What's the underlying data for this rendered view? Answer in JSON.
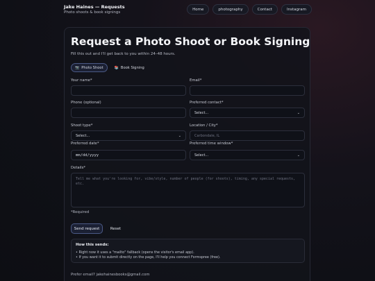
{
  "header": {
    "title": "Jake Haines — Requests",
    "subtitle": "Photo shoots & book signings",
    "nav": [
      "Home",
      "photography",
      "Contact",
      "Instagram"
    ]
  },
  "form": {
    "title": "Request a Photo Shoot or Book Signing",
    "intro": "Fill this out and I'll get back to you within 24–48 hours.",
    "tabs": [
      {
        "icon": "camera-icon",
        "label": "Photo Shoot",
        "active": true
      },
      {
        "icon": "books-icon",
        "label": "Book Signing",
        "active": false
      }
    ],
    "name_label": "Your name*",
    "email_label": "Email*",
    "phone_label": "Phone (optional)",
    "contact_label": "Preferred contact*",
    "contact_value": "Select...",
    "shoot_type_label": "Shoot type*",
    "shoot_type_value": "Select...",
    "location_label": "Location / City*",
    "location_placeholder": "Carbondale, IL",
    "date_label": "Preferred date*",
    "date_placeholder": "mm/dd/yyyy",
    "time_label": "Preferred time window*",
    "time_value": "Select...",
    "details_label": "Details*",
    "details_placeholder": "Tell me what you're looking for, vibe/style, number of people (for shoots), timing, any special requests, etc.",
    "required_note": "*Required",
    "send_label": "Send request",
    "reset_label": "Reset",
    "info": {
      "title": "How this sends:",
      "lines": [
        "• Right now it uses a \"mailto\" fallback (opens the visitor's email app).",
        "• If you want it to submit directly on the page, I'll help you connect Formspree (free)."
      ]
    },
    "footer_note": "Prefer email? jakehainesbooks@gmail.com"
  }
}
